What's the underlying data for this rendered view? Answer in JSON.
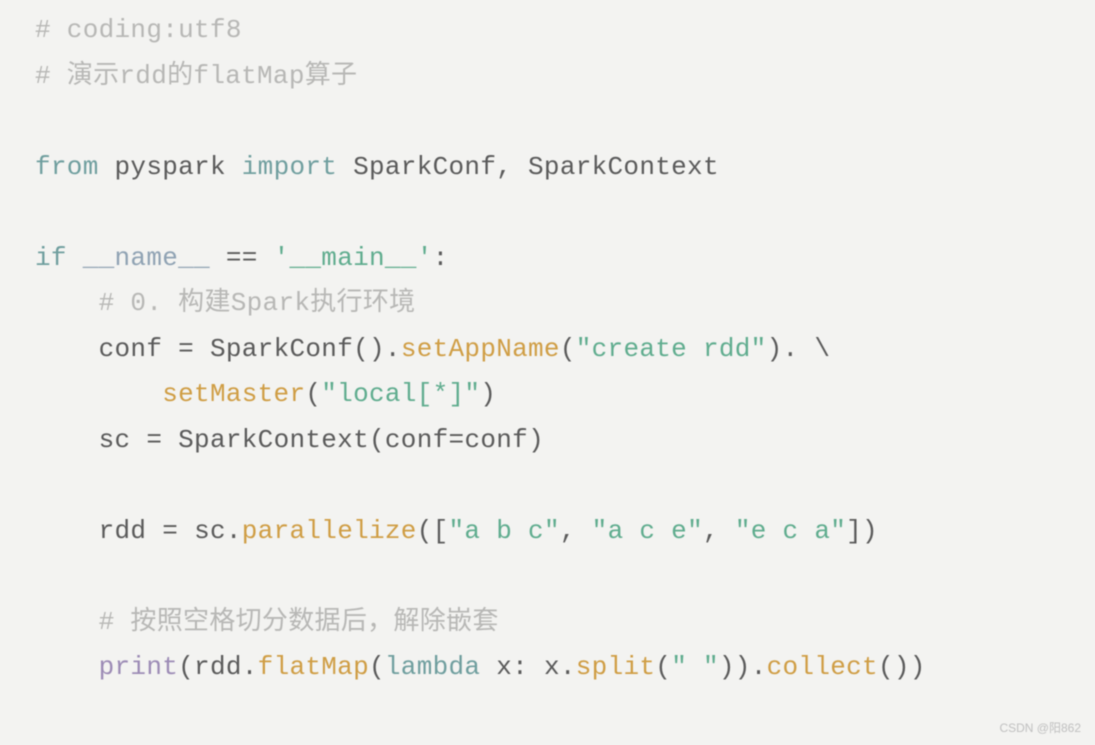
{
  "code": {
    "line1_comment": "# coding:utf8",
    "line2_comment": "# 演示rdd的flatMap算子",
    "line4_from": "from",
    "line4_module": "pyspark",
    "line4_import": "import",
    "line4_imports": "SparkConf, SparkContext",
    "line6_if": "if",
    "line6_name": "__name__",
    "line6_eq": "==",
    "line6_main": "'__main__'",
    "line6_colon": ":",
    "line7_comment": "# 0. 构建Spark执行环境",
    "line8_conf": "conf",
    "line8_eq": "=",
    "line8_sparkconf": "SparkConf",
    "line8_paren1": "().",
    "line8_setappname": "setAppName",
    "line8_paren2": "(",
    "line8_str": "\"create rdd\"",
    "line8_paren3": ").",
    "line8_cont": "\\",
    "line9_setmaster": "setMaster",
    "line9_paren1": "(",
    "line9_str": "\"local[*]\"",
    "line9_paren2": ")",
    "line10_sc": "sc",
    "line10_eq": "=",
    "line10_sparkcontext": "SparkContext",
    "line10_paren1": "(",
    "line10_confkw": "conf",
    "line10_eq2": "=",
    "line10_confval": "conf",
    "line10_paren2": ")",
    "line12_rdd": "rdd",
    "line12_eq": "=",
    "line12_sc": "sc.",
    "line12_parallelize": "parallelize",
    "line12_paren1": "([",
    "line12_str1": "\"a b c\"",
    "line12_comma1": ",",
    "line12_str2": "\"a c e\"",
    "line12_comma2": ",",
    "line12_str3": "\"e c a\"",
    "line12_paren2": "])",
    "line14_comment": "# 按照空格切分数据后，解除嵌套",
    "line15_print": "print",
    "line15_paren1": "(",
    "line15_rdd": "rdd.",
    "line15_flatmap": "flatMap",
    "line15_paren2": "(",
    "line15_lambda": "lambda",
    "line15_x": "x:",
    "line15_xsplit": "x.",
    "line15_split": "split",
    "line15_paren3": "(",
    "line15_str": "\" \"",
    "line15_paren4": ")).",
    "line15_collect": "collect",
    "line15_paren5": "())"
  },
  "watermark": "CSDN @阳862"
}
